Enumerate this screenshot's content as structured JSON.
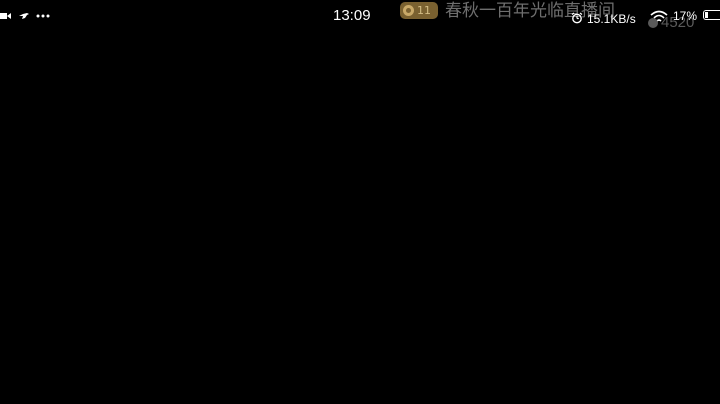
{
  "status_bar": {
    "time": "13:09",
    "network_speed": "15.1KB/s",
    "battery_percent": "17%",
    "battery_level": 0.17,
    "icons": [
      "video-camera-icon",
      "bird-icon",
      "more-dots-icon",
      "alarm-icon",
      "wifi-icon",
      "battery-icon"
    ]
  },
  "overlay": {
    "badge_number": "11",
    "title": "春秋一百年光临直播间",
    "viewer_count": "4520"
  },
  "colors": {
    "background": "#000000",
    "badge": "#7a6130",
    "overlay_text": "#6e6e6e"
  }
}
